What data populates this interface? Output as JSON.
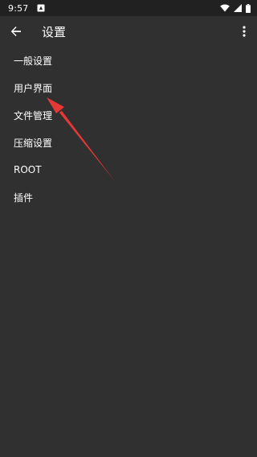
{
  "status_bar": {
    "time": "9:57",
    "icons": [
      "notification-icon",
      "wifi-icon",
      "signal-icon",
      "battery-icon"
    ]
  },
  "toolbar": {
    "title": "设置",
    "back_icon": "arrow-back-icon",
    "overflow_icon": "more-vert-icon"
  },
  "settings": {
    "items": [
      {
        "label": "一般设置"
      },
      {
        "label": "用户界面"
      },
      {
        "label": "文件管理"
      },
      {
        "label": "压缩设置"
      },
      {
        "label": "ROOT"
      },
      {
        "label": "插件"
      }
    ]
  },
  "colors": {
    "background": "#303030",
    "status_bar": "#212121",
    "text": "#ffffff",
    "annotation": "#e53935"
  }
}
